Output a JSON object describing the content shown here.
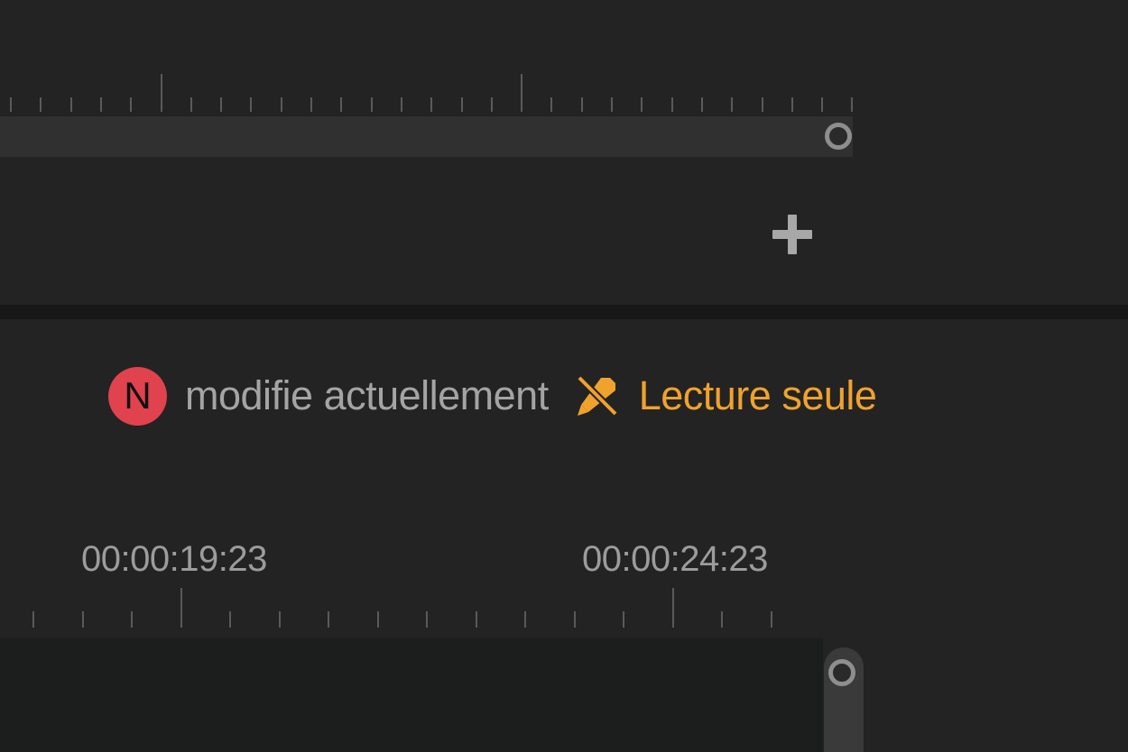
{
  "top_panel": {
    "add_button_icon": "plus-icon"
  },
  "status": {
    "user_initial": "N",
    "user_avatar_color": "#e0424e",
    "editing_text": "modifie actuellement",
    "readonly_icon": "pencil-crossed-icon",
    "readonly_label": "Lecture seule",
    "readonly_color": "#f0a22e"
  },
  "timeline": {
    "timecodes": [
      "00:00:19:23",
      "00:00:24:23"
    ]
  }
}
